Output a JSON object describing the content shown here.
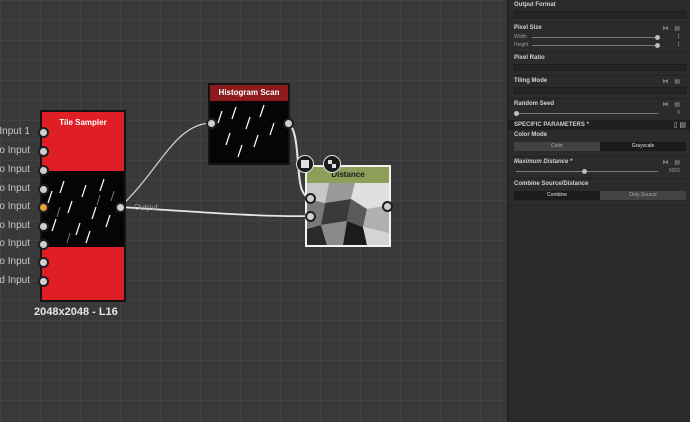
{
  "graph": {
    "input_labels": [
      "Input 1",
      "o Input",
      "o Input",
      "o Input",
      "o Input",
      "o Input",
      "o Input",
      "o Input",
      "d Input"
    ],
    "nodes": {
      "tile_sampler": {
        "title": "Tile Sampler",
        "size": "2048x2048 - L16",
        "output_label": "Output"
      },
      "histogram_scan": {
        "title": "Histogram Scan"
      },
      "distance": {
        "title": "Distance"
      }
    }
  },
  "panel": {
    "output_format": {
      "title": "Output Format"
    },
    "pixel_size": {
      "title": "Pixel Size",
      "width_label": "Width",
      "height_label": "Height",
      "width_value": "1",
      "height_value": "1"
    },
    "pixel_ratio": {
      "title": "Pixel Ratio"
    },
    "tiling_mode": {
      "title": "Tiling Mode"
    },
    "random_seed": {
      "title": "Random Seed",
      "value": "0"
    },
    "specific": {
      "title": "SPECIFIC PARAMETERS *"
    },
    "color_mode": {
      "title": "Color Mode",
      "options": [
        "Color",
        "Grayscale"
      ],
      "selected": "Grayscale"
    },
    "max_distance": {
      "title": "Maximum Distance *",
      "value": "5006"
    },
    "combine": {
      "title": "Combine Source/Distance",
      "options": [
        "Combine",
        "Only Source"
      ],
      "selected": "Combine"
    }
  }
}
